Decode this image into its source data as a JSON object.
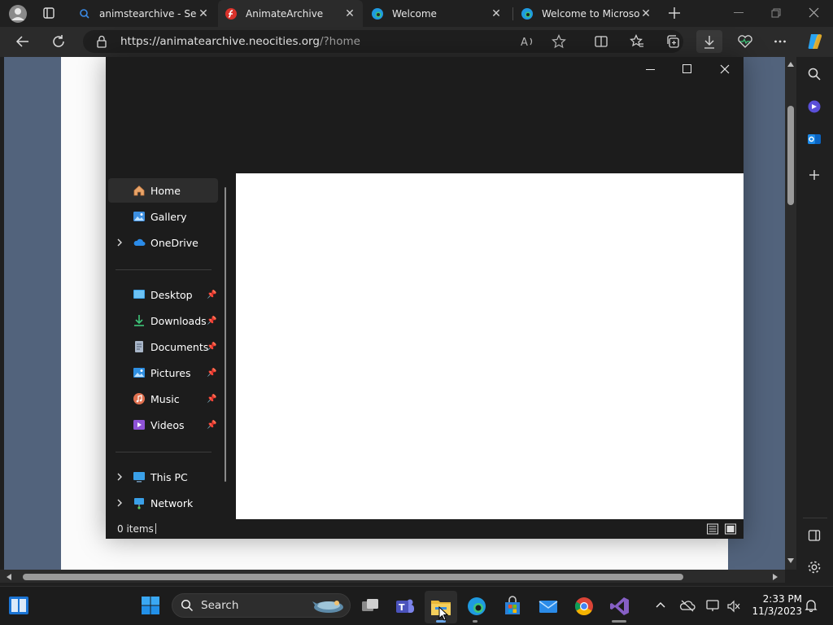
{
  "browser": {
    "tabs": [
      {
        "title": "animstearchive - Sear",
        "active": false
      },
      {
        "title": "AnimateArchive",
        "active": true
      },
      {
        "title": "Welcome",
        "active": false
      },
      {
        "title": "Welcome to Microsoft",
        "active": false
      }
    ],
    "url_host": "https://animatearchive.neocities.org",
    "url_path": "/?home"
  },
  "explorer": {
    "nav": {
      "home": "Home",
      "gallery": "Gallery",
      "onedrive": "OneDrive",
      "desktop": "Desktop",
      "downloads": "Downloads",
      "documents": "Documents",
      "pictures": "Pictures",
      "music": "Music",
      "videos": "Videos",
      "this_pc": "This PC",
      "network": "Network"
    },
    "status": "0 items"
  },
  "taskbar": {
    "search_label": "Search",
    "time": "2:33 PM",
    "date": "11/3/2023"
  },
  "colors": {
    "accent": "#0078d4",
    "page_bg": "#52637c",
    "window_bg": "#1c1c1c"
  }
}
